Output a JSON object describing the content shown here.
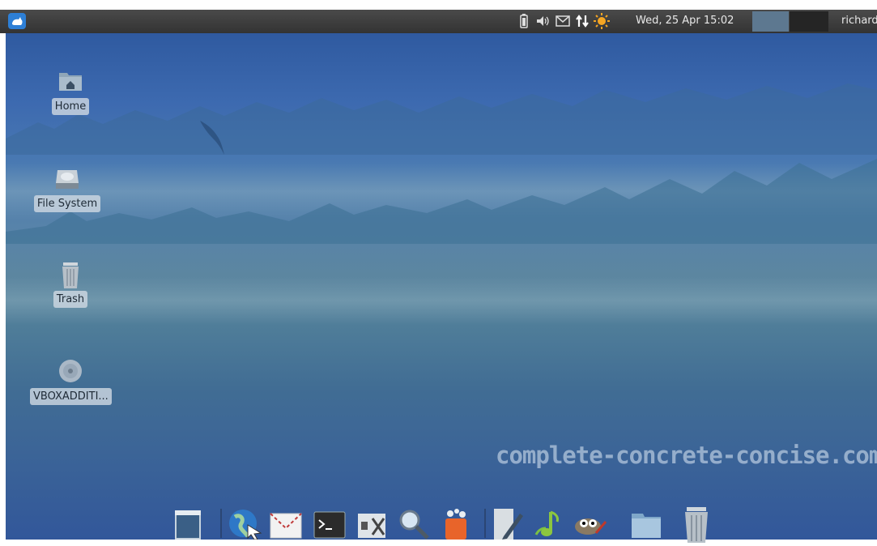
{
  "panel": {
    "menu_icon": "xfce-mouse-icon",
    "tray_icons": [
      "battery-icon",
      "volume-icon",
      "mail-icon",
      "network-transfer-icon",
      "updates-sun-icon"
    ],
    "clock": "Wed, 25 Apr  15:02",
    "user": "richard"
  },
  "desktop": {
    "icons": [
      {
        "label": "Home",
        "icon": "home-folder-icon"
      },
      {
        "label": "File System",
        "icon": "hard-drive-icon"
      },
      {
        "label": "Trash",
        "icon": "trash-icon"
      },
      {
        "label": "VBOXADDITI...",
        "icon": "optical-disc-icon"
      }
    ],
    "watermark": "complete-concrete-concise.com"
  },
  "dock": {
    "items": [
      "show-desktop-icon",
      "web-browser-icon",
      "mail-client-icon",
      "terminal-icon",
      "settings-manager-icon",
      "search-icon",
      "software-store-icon",
      "text-editor-icon",
      "music-player-icon",
      "image-editor-icon",
      "file-manager-icon",
      "trash-icon"
    ]
  },
  "colors": {
    "panel_bg": "#3a3a3a",
    "accent": "#5d7890"
  }
}
